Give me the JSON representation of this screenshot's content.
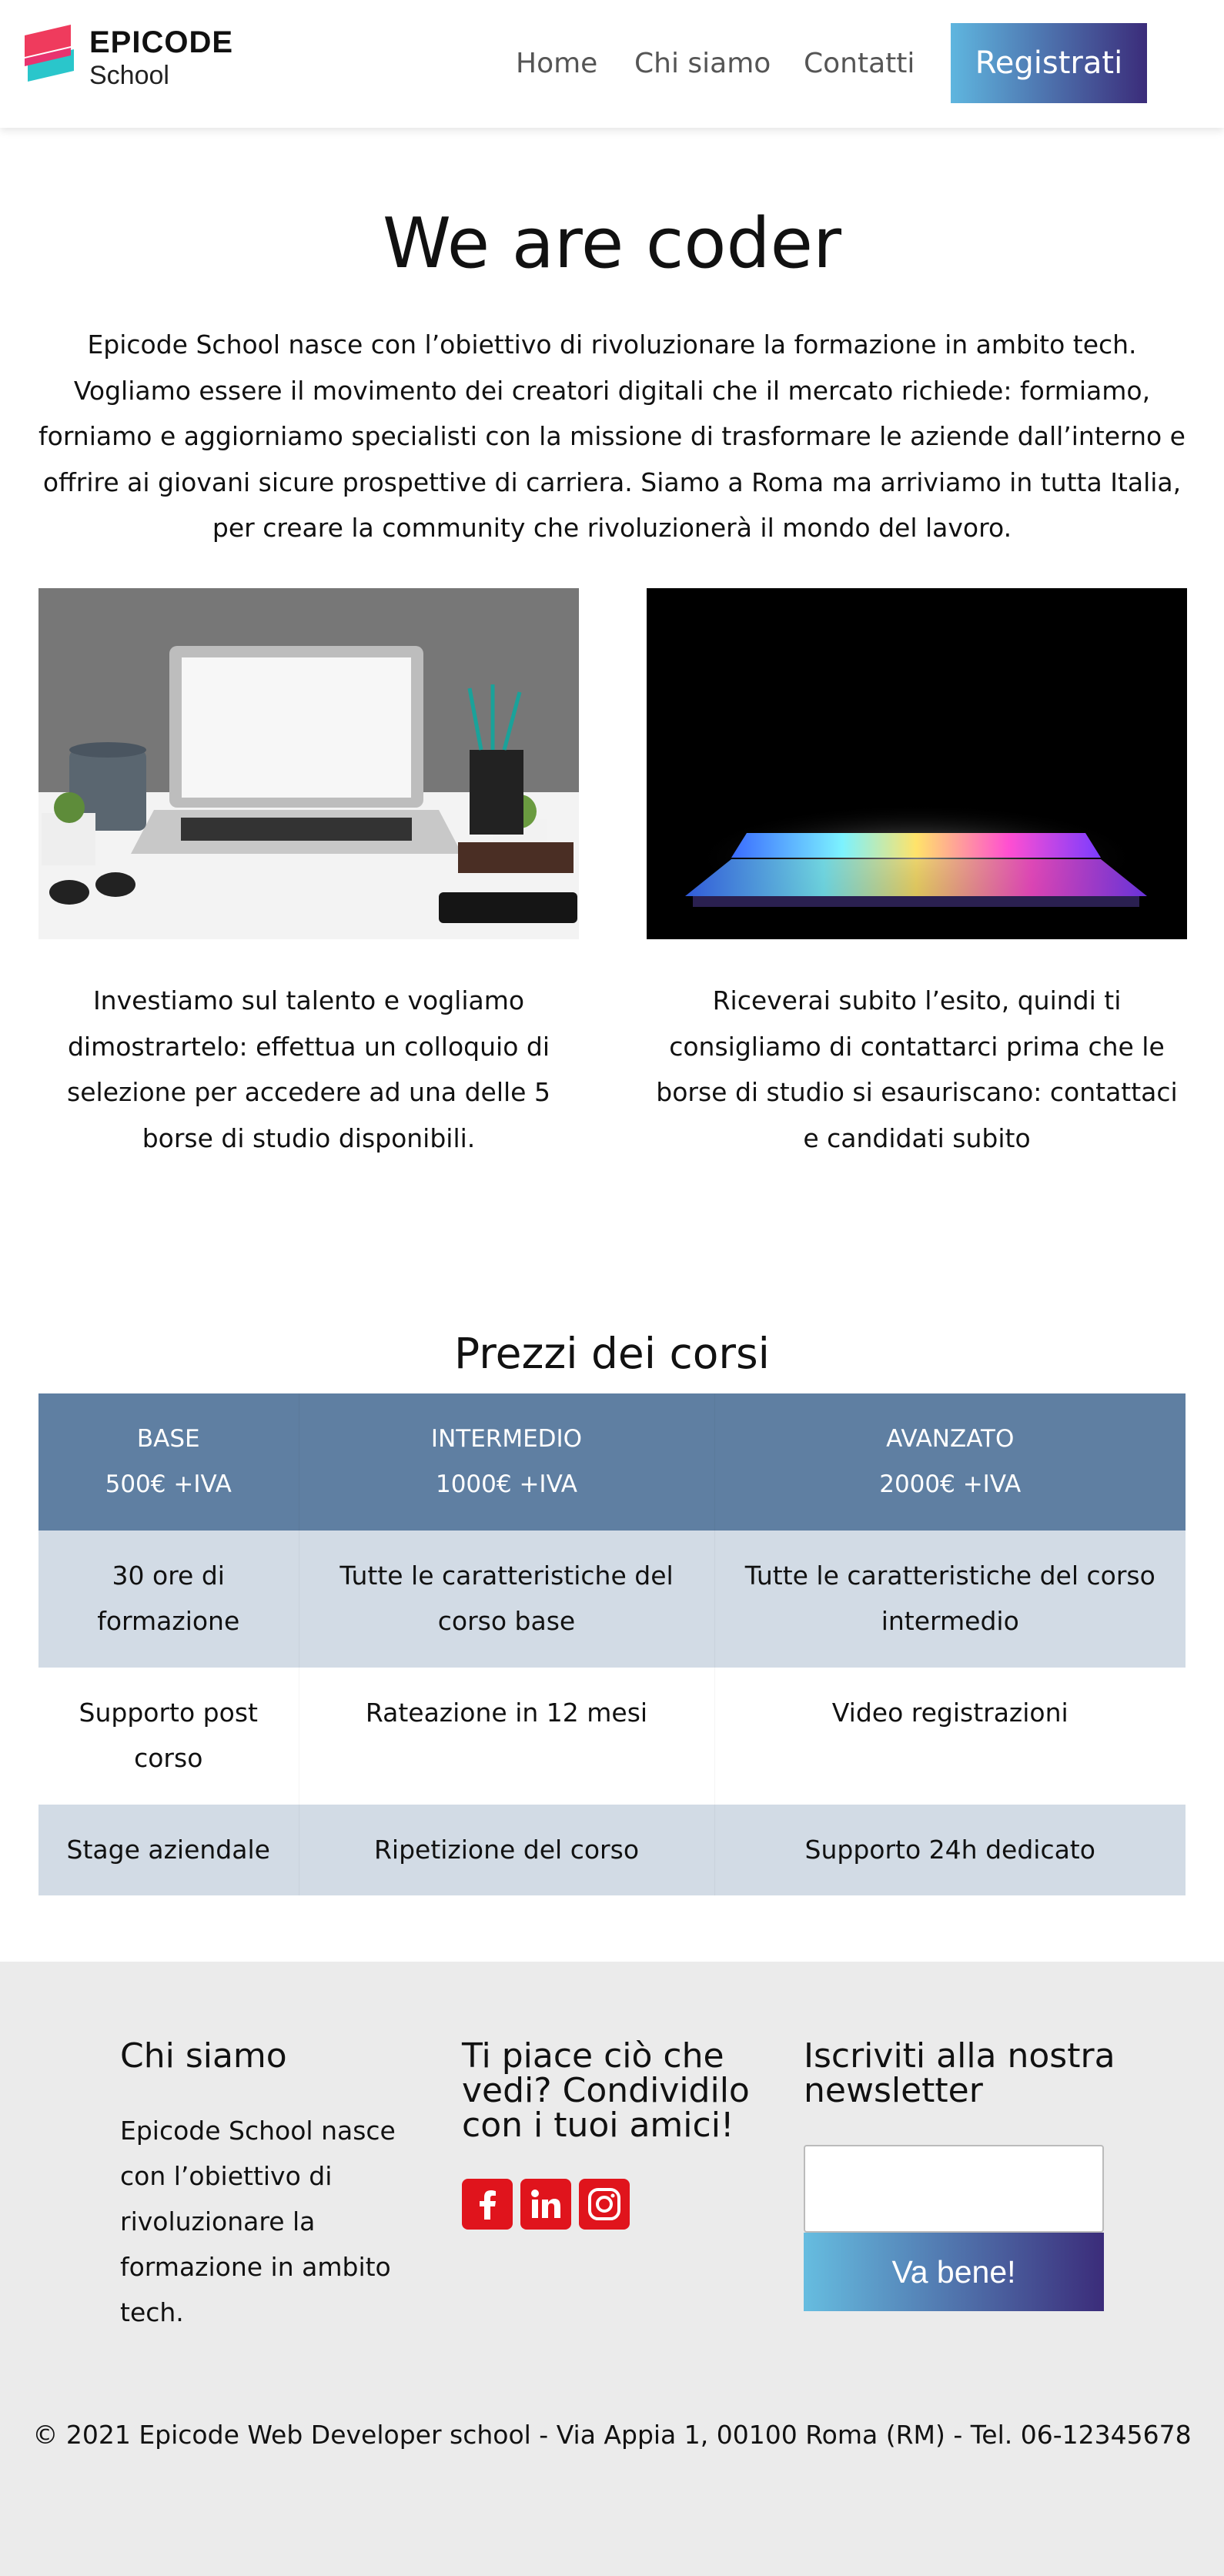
{
  "brand": {
    "name_line1": "EPICODE",
    "name_line2": "School",
    "logo_colors": [
      "#ef3b5d",
      "#1fc3c8"
    ]
  },
  "nav": {
    "items": [
      {
        "label": "Home"
      },
      {
        "label": "Chi siamo"
      },
      {
        "label": "Contatti"
      }
    ],
    "cta_label": "Registrati",
    "cta_gradient": [
      "#5fb6df",
      "#3b2c7a"
    ]
  },
  "hero": {
    "title": "We are coder",
    "text": "Epicode School nasce con l’obiettivo di rivoluzionare la formazione in ambito tech. Vogliamo essere il movimento dei creatori digitali che il mercato richiede: formiamo, forniamo e aggiorniamo specialisti con la missione di trasformare le aziende dall’interno e offrire ai giovani sicure prospettive di carriera. Siamo a Roma ma arriviamo in tutta Italia, per creare la community che rivoluzionerà il mondo del lavoro."
  },
  "cards": [
    {
      "image": "laptop-on-desk-photo",
      "text": "Investiamo sul talento e vogliamo dimostrartelo: effettua un colloquio di selezione per accedere ad una delle 5 borse di studio disponibili."
    },
    {
      "image": "glowing-laptop-photo",
      "text": "Riceverai subito l’esito, quindi ti consigliamo di contattarci prima che le borse di studio si esauriscano: contattaci e candidati subito"
    }
  ],
  "prices": {
    "title": "Prezzi dei corsi",
    "header_color": "#5f7fa2",
    "row_alt_color": "#d2dbe5",
    "plans": [
      {
        "name": "BASE",
        "price": "500€ +IVA"
      },
      {
        "name": "INTERMEDIO",
        "price": "1000€ +IVA"
      },
      {
        "name": "AVANZATO",
        "price": "2000€ +IVA"
      }
    ],
    "rows": [
      [
        "30 ore di formazione",
        "Tutte le caratteristiche del corso base",
        "Tutte le caratteristiche del corso intermedio"
      ],
      [
        "Supporto post corso",
        "Rateazione in 12 mesi",
        "Video registrazioni"
      ],
      [
        "Stage aziendale",
        "Ripetizione del corso",
        "Supporto 24h dedicato"
      ]
    ]
  },
  "footer": {
    "about_title": "Chi siamo",
    "about_text": "Epicode School nasce con l’obiettivo di rivoluzionare la formazione in ambito tech.",
    "share_title": "Ti piace ciò che vedi? Condividilo con i tuoi amici!",
    "social": [
      "facebook-icon",
      "linkedin-icon",
      "instagram-icon"
    ],
    "social_color": "#e0141c",
    "newsletter_title": "Iscriviti alla nostra newsletter",
    "newsletter_value": "",
    "newsletter_button": "Va bene!",
    "copyright": "© 2021 Epicode Web Developer school - Via Appia 1, 00100 Roma (RM) - Tel. 06-12345678"
  }
}
